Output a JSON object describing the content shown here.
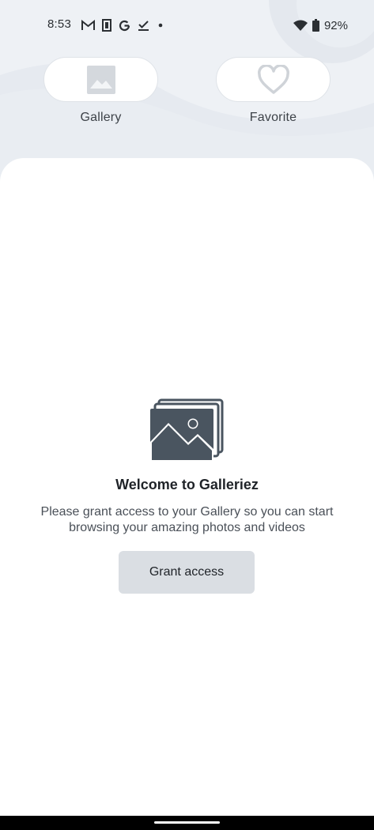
{
  "status_bar": {
    "time": "8:53",
    "notification_icons": [
      "gmail-icon",
      "clipboard-icon",
      "google-icon",
      "task-check-icon",
      "dot-icon"
    ],
    "wifi": "wifi-icon",
    "battery_icon": "battery-icon",
    "battery_percent": "92%"
  },
  "tabs": [
    {
      "label": "Gallery",
      "icon": "image-icon"
    },
    {
      "label": "Favorite",
      "icon": "heart-icon"
    }
  ],
  "empty_state": {
    "icon": "photos-stack-icon",
    "title": "Welcome to Galleriez",
    "message": "Please grant access to your Gallery so you can start browsing your amazing photos and videos",
    "button_label": "Grant access"
  },
  "colors": {
    "background": "#eef1f5",
    "sheet": "#ffffff",
    "button": "#dadee3",
    "icon_dark": "#4a5560"
  }
}
